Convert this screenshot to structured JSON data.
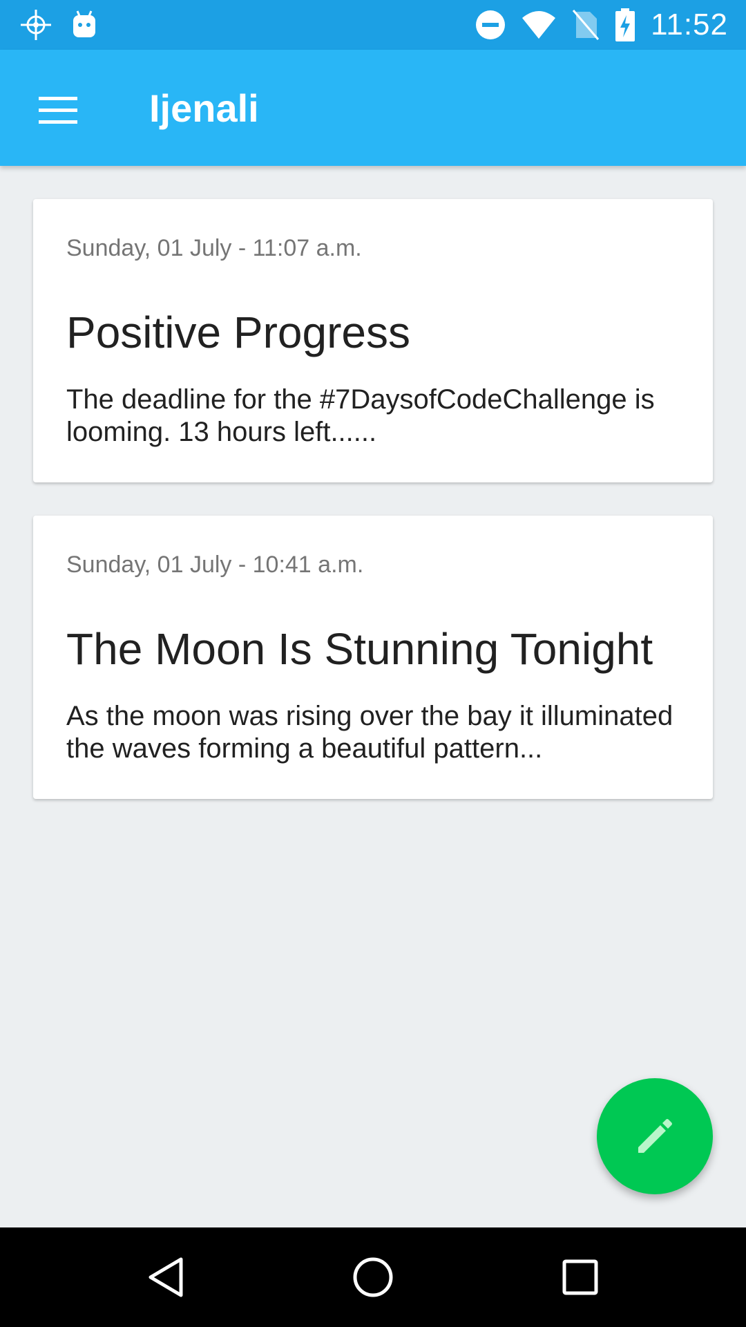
{
  "status_bar": {
    "time": "11:52",
    "left_icons": [
      "crosshair-icon",
      "android-debug-icon"
    ],
    "right_icons": [
      "do-not-disturb-icon",
      "wifi-icon",
      "no-sim-icon",
      "battery-charging-icon"
    ]
  },
  "app_bar": {
    "title": "Ijenali",
    "menu_icon": "hamburger-menu-icon",
    "color": "#29b6f6"
  },
  "entries": [
    {
      "date": "Sunday, 01 July - 11:07 a.m.",
      "title": "Positive Progress",
      "body": "The deadline for the #7DaysofCodeChallenge is looming. 13 hours left......"
    },
    {
      "date": "Sunday, 01 July - 10:41 a.m.",
      "title": "The Moon Is Stunning Tonight",
      "body": "As the moon was rising over the bay it illuminated the waves forming a beautiful pattern..."
    }
  ],
  "fab": {
    "icon": "pencil-icon",
    "color": "#00c853"
  },
  "nav_bar": {
    "buttons": [
      "back-icon",
      "home-icon",
      "recents-icon"
    ]
  }
}
